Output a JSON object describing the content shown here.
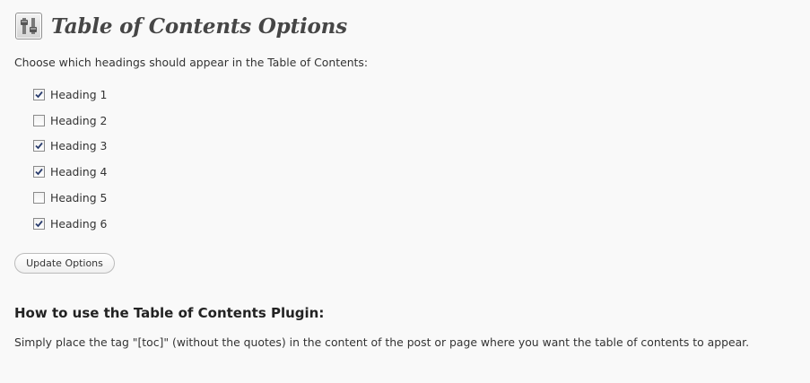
{
  "header": {
    "icon": "settings-sliders-icon",
    "title": "Table of Contents Options"
  },
  "form": {
    "intro": "Choose which headings should appear in the Table of Contents:",
    "headings": [
      {
        "label": "Heading 1",
        "checked": true
      },
      {
        "label": "Heading 2",
        "checked": false
      },
      {
        "label": "Heading 3",
        "checked": true
      },
      {
        "label": "Heading 4",
        "checked": true
      },
      {
        "label": "Heading 5",
        "checked": false
      },
      {
        "label": "Heading 6",
        "checked": true
      }
    ],
    "submit_label": "Update Options"
  },
  "howto": {
    "title": "How to use the Table of Contents Plugin:",
    "text": "Simply place the tag \"[toc]\" (without the quotes) in the content of the post or page where you want the table of contents to appear."
  },
  "colors": {
    "background": "#f9f9f9",
    "text": "#333333",
    "check": "#2a3d6e"
  }
}
